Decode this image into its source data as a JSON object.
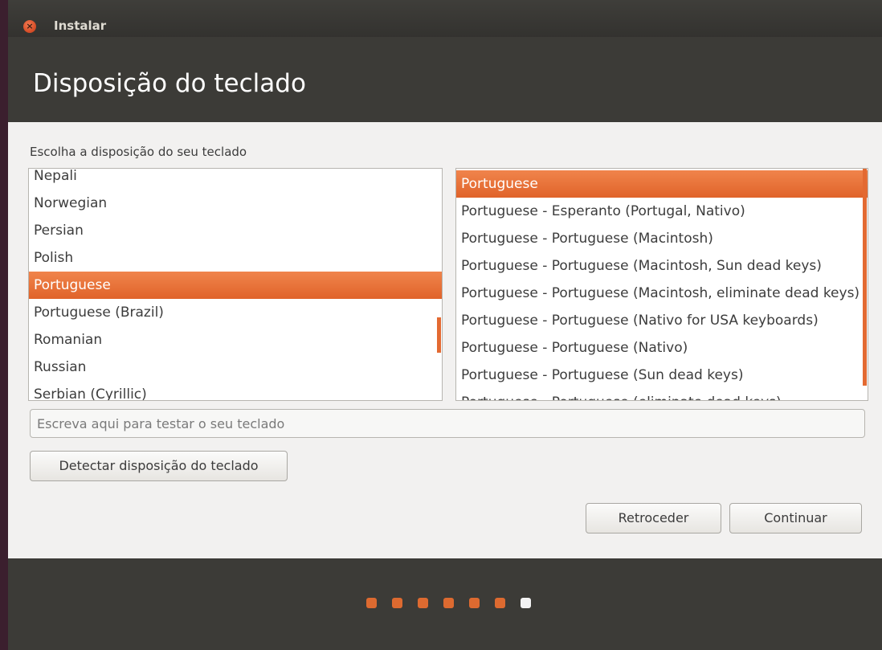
{
  "window": {
    "title": "Instalar",
    "close_glyph": "×",
    "close_icon": "close-icon"
  },
  "page": {
    "title": "Disposição do teclado",
    "prompt": "Escolha a disposição do seu teclado"
  },
  "layouts": {
    "items": [
      "Nepali",
      "Norwegian",
      "Persian",
      "Polish",
      "Portuguese",
      "Portuguese (Brazil)",
      "Romanian",
      "Russian",
      "Serbian (Cyrillic)"
    ],
    "selected": "Portuguese"
  },
  "variants": {
    "items": [
      "Portuguese",
      "Portuguese - Esperanto (Portugal, Nativo)",
      "Portuguese - Portuguese (Macintosh)",
      "Portuguese - Portuguese (Macintosh, Sun dead keys)",
      "Portuguese - Portuguese (Macintosh, eliminate dead keys)",
      "Portuguese - Portuguese (Nativo for USA keyboards)",
      "Portuguese - Portuguese (Nativo)",
      "Portuguese - Portuguese (Sun dead keys)",
      "Portuguese - Portuguese (eliminate dead keys)"
    ],
    "selected": "Portuguese"
  },
  "test_input": {
    "placeholder": "Escreva aqui para testar o seu teclado",
    "value": ""
  },
  "buttons": {
    "detect": "Detectar disposição do teclado",
    "back": "Retroceder",
    "continue": "Continuar"
  },
  "progress": {
    "total_steps": 7,
    "current_step": 7
  },
  "colors": {
    "accent": "#e0632a",
    "header": "#3c3b37",
    "background": "#f2f1f0"
  }
}
